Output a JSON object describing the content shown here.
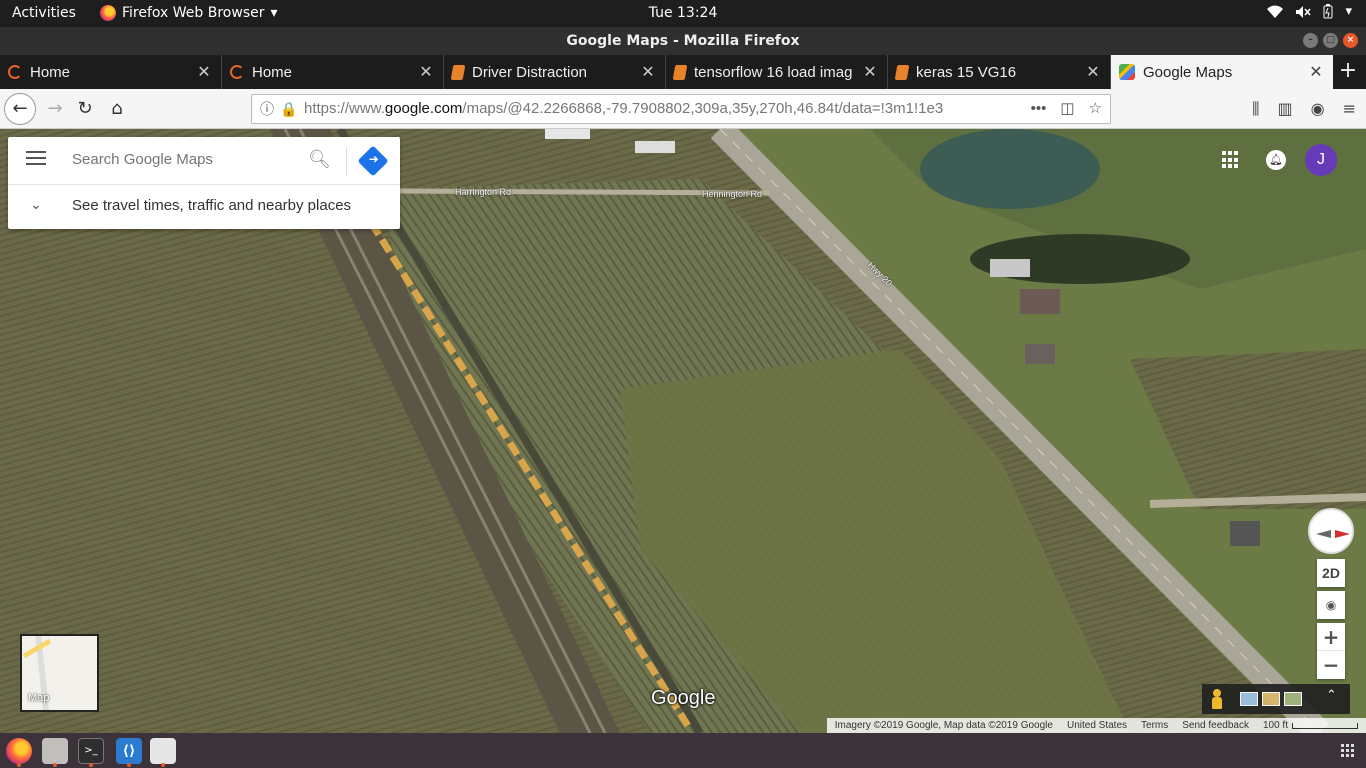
{
  "topbar": {
    "activities": "Activities",
    "app_name": "Firefox Web Browser",
    "clock": "Tue 13:24"
  },
  "window": {
    "title": "Google Maps - Mozilla Firefox"
  },
  "tabs": [
    {
      "label": "Home",
      "icon": "loading-spinner-icon"
    },
    {
      "label": "Home",
      "icon": "loading-spinner-icon"
    },
    {
      "label": "Driver Distraction",
      "icon": "notebook-icon"
    },
    {
      "label": "tensorflow 16 load imag",
      "icon": "notebook-icon"
    },
    {
      "label": "keras 15 VG16",
      "icon": "notebook-icon"
    },
    {
      "label": "Google Maps",
      "icon": "google-maps-icon",
      "active": true
    }
  ],
  "nav": {
    "url_prefix": "https://www.",
    "url_domain": "google.com",
    "url_rest": "/maps/@42.2266868,-79.7908802,309a,35y,270h,46.84t/data=!3m1!1e3"
  },
  "maps": {
    "search_placeholder": "Search Google Maps",
    "travel_prompt": "See travel times, traffic and nearby places",
    "avatar_letter": "J",
    "mode_2d": "2D",
    "zoom_in": "+",
    "zoom_out": "−",
    "minimap_label": "Map",
    "logo": "Google",
    "road_labels": [
      "Hwy 20",
      "Harrington Rd",
      "Hennington Rd"
    ],
    "footer": {
      "imagery": "Imagery ©2019 Google, Map data ©2019 Google",
      "country": "United States",
      "terms": "Terms",
      "feedback": "Send feedback",
      "scale": "100 ft"
    }
  },
  "colors": {
    "accent_blue": "#1a73e8",
    "avatar_purple": "#673ab7",
    "close_orange": "#e9572c"
  }
}
